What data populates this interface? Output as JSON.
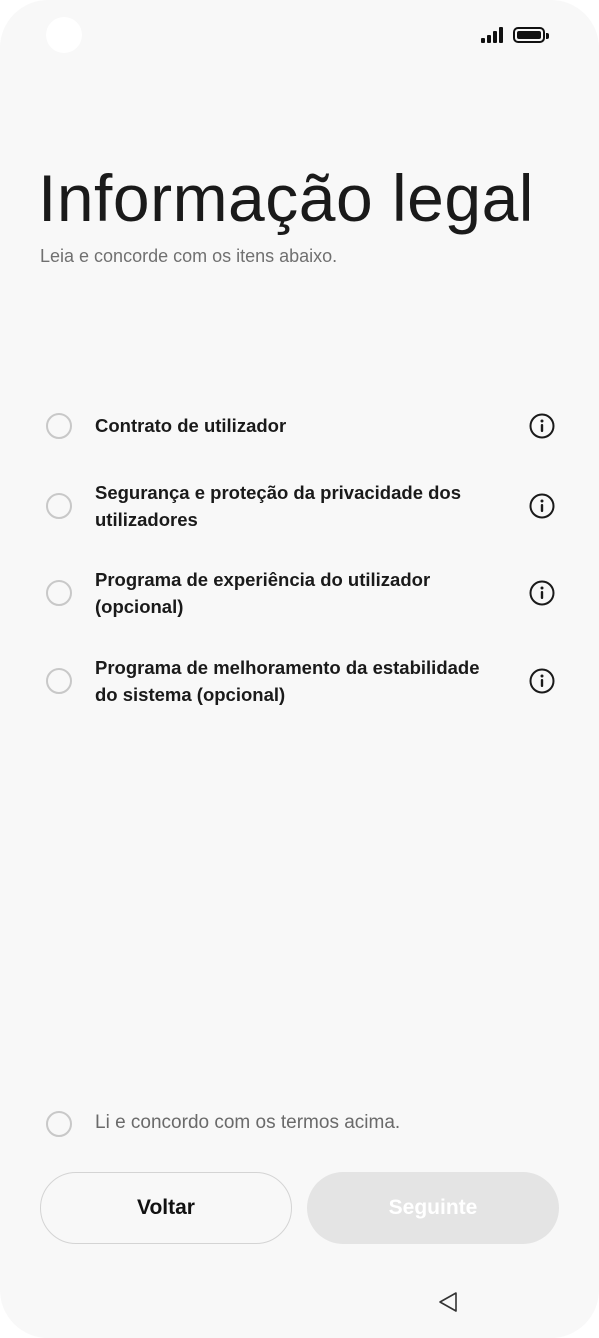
{
  "header": {
    "title": "Informação legal",
    "subtitle": "Leia e concorde com os itens abaixo."
  },
  "status_bar": {
    "signal_icon": "signal-icon",
    "battery_icon": "battery-icon"
  },
  "items": [
    {
      "label": "Contrato de utilizador",
      "checked": false,
      "info_icon": "info-icon"
    },
    {
      "label": "Segurança e proteção da privacidade dos utilizadores",
      "checked": false,
      "info_icon": "info-icon"
    },
    {
      "label": "Programa de experiência do utilizador (opcional)",
      "checked": false,
      "info_icon": "info-icon"
    },
    {
      "label": "Programa de melhoramento da estabilidade do sistema (opcional)",
      "checked": false,
      "info_icon": "info-icon"
    }
  ],
  "agree": {
    "label": "Li e concordo com os termos acima.",
    "checked": false
  },
  "buttons": {
    "back_label": "Voltar",
    "next_label": "Seguinte",
    "next_enabled": false
  },
  "nav": {
    "back_icon": "back-triangle-icon"
  },
  "colors": {
    "background": "#f8f8f8",
    "text_primary": "#1a1a1a",
    "text_secondary": "#707070",
    "radio_border": "#c8c8c8",
    "disabled_button": "#e4e4e4"
  }
}
